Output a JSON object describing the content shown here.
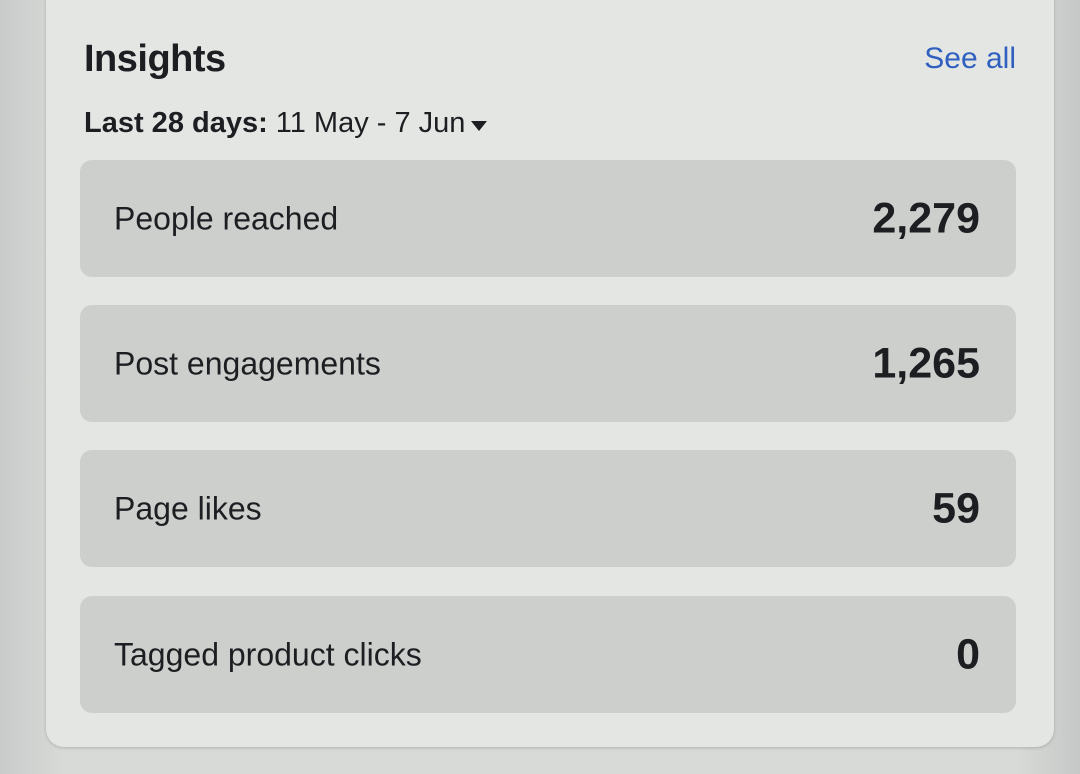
{
  "insights": {
    "title": "Insights",
    "see_all_label": "See all",
    "date_range": {
      "prefix": "Last 28 days:",
      "dates": "11 May - 7 Jun",
      "icon": "caret-down-icon"
    },
    "metrics": [
      {
        "label": "People reached",
        "value": "2,279"
      },
      {
        "label": "Post engagements",
        "value": "1,265"
      },
      {
        "label": "Page likes",
        "value": "59"
      },
      {
        "label": "Tagged product clicks",
        "value": "0"
      }
    ]
  },
  "colors": {
    "link": "#2f5fbf",
    "card_background": "#e4e6e4",
    "metric_background": "#cdcfcd",
    "text": "#1c1e21"
  }
}
